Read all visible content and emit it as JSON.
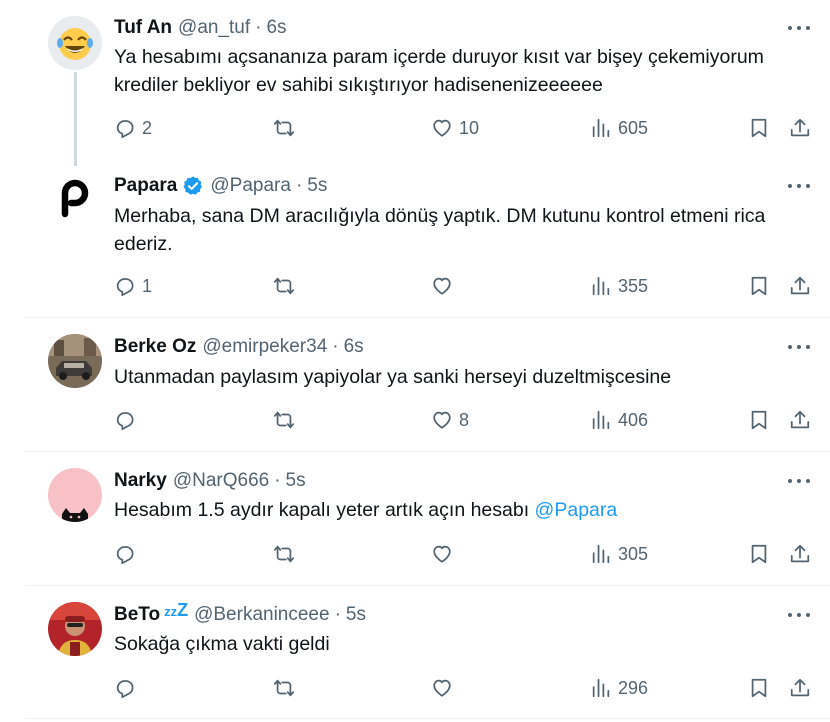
{
  "tweets": [
    {
      "name": "Tuf An",
      "handle": "@an_tuf",
      "time": "6s",
      "text": "Ya hesabımı açsananıza param içerde duruyor kısıt var bişey çekemiyorum krediler bekliyor ev sahibi sıkıştırıyor hadisenenizeeeeee",
      "replies": "2",
      "retweets": "",
      "likes": "10",
      "views": "605",
      "avatar": "laughing-emoji-avatar"
    },
    {
      "name": "Papara",
      "handle": "@Papara",
      "time": "5s",
      "verified": true,
      "text": "Merhaba, sana DM aracılığıyla dönüş yaptık. DM kutunu kontrol etmeni rica ederiz.",
      "replies": "1",
      "retweets": "",
      "likes": "",
      "views": "355",
      "avatar": "papara-logo-avatar"
    },
    {
      "name": "Berke Oz",
      "handle": "@emirpeker34",
      "time": "6s",
      "text": "Utanmadan paylasım yapiyolar ya sanki herseyi duzeltmişcesine",
      "replies": "",
      "retweets": "",
      "likes": "8",
      "views": "406",
      "avatar": "car-photo-avatar"
    },
    {
      "name": "Narky",
      "handle": "@NarQ666",
      "time": "5s",
      "text_before": "Hesabım 1.5 aydır kapalı yeter artık açın hesabı ",
      "mention": "@Papara",
      "replies": "",
      "retweets": "",
      "likes": "",
      "views": "305",
      "avatar": "pink-cat-avatar"
    },
    {
      "name": "BeTo",
      "handle": "@Berkaninceee",
      "time": "5s",
      "name_suffix_small": "zz",
      "name_suffix_big": "Z",
      "text": "Sokağa çıkma vakti geldi",
      "replies": "",
      "retweets": "",
      "likes": "",
      "views": "296",
      "avatar": "person-photo-avatar"
    }
  ],
  "separator": "·",
  "colors": {
    "text": "#0f1419",
    "secondary": "#536471",
    "accent": "#1d9bf0",
    "divider": "#eff3f4",
    "thread_line": "#cfd9de"
  }
}
